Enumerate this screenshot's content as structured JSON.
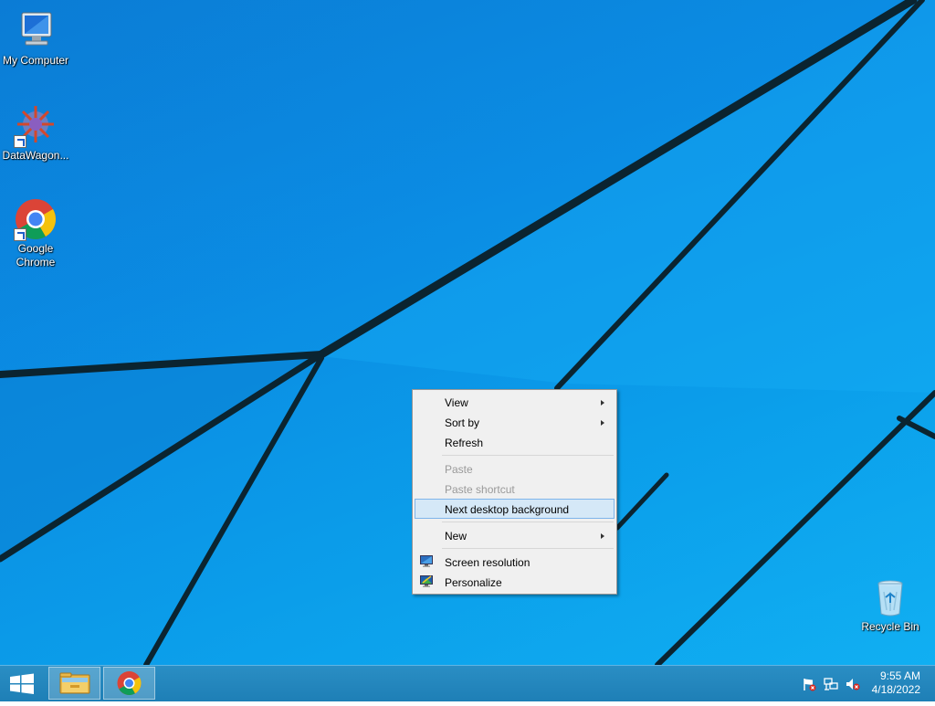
{
  "desktop": {
    "icons": [
      {
        "label": "My Computer",
        "icon": "computer-icon"
      },
      {
        "label": "DataWagon...",
        "icon": "datawagon-icon"
      },
      {
        "label": "Google Chrome",
        "icon": "chrome-icon"
      },
      {
        "label": "Recycle Bin",
        "icon": "recycle-bin-icon"
      }
    ]
  },
  "context_menu": {
    "items": [
      {
        "label": "View",
        "submenu": true,
        "enabled": true
      },
      {
        "label": "Sort by",
        "submenu": true,
        "enabled": true
      },
      {
        "label": "Refresh",
        "submenu": false,
        "enabled": true
      },
      {
        "label": "Paste",
        "submenu": false,
        "enabled": false
      },
      {
        "label": "Paste shortcut",
        "submenu": false,
        "enabled": false
      },
      {
        "label": "Next desktop background",
        "submenu": false,
        "enabled": true,
        "highlighted": true
      },
      {
        "label": "New",
        "submenu": true,
        "enabled": true
      },
      {
        "label": "Screen resolution",
        "submenu": false,
        "enabled": true,
        "icon": "screen-resolution-icon"
      },
      {
        "label": "Personalize",
        "submenu": false,
        "enabled": true,
        "icon": "personalize-icon"
      }
    ]
  },
  "taskbar": {
    "start_icon": "windows-logo-icon",
    "pinned": [
      {
        "app": "File Explorer",
        "icon": "file-explorer-icon"
      },
      {
        "app": "Google Chrome",
        "icon": "chrome-icon"
      }
    ],
    "tray": {
      "icons": [
        "action-center-flag-icon",
        "network-icon",
        "speaker-muted-icon"
      ],
      "time": "9:55 AM",
      "date": "4/18/2022"
    }
  },
  "colors": {
    "desktop_blue": "#0a9cee",
    "taskbar": "#2589c0",
    "menu_bg": "#f0f0f0",
    "menu_highlight": "#d5e8f7",
    "menu_highlight_border": "#7eb4ea",
    "disabled_text": "#9a9a9a"
  }
}
